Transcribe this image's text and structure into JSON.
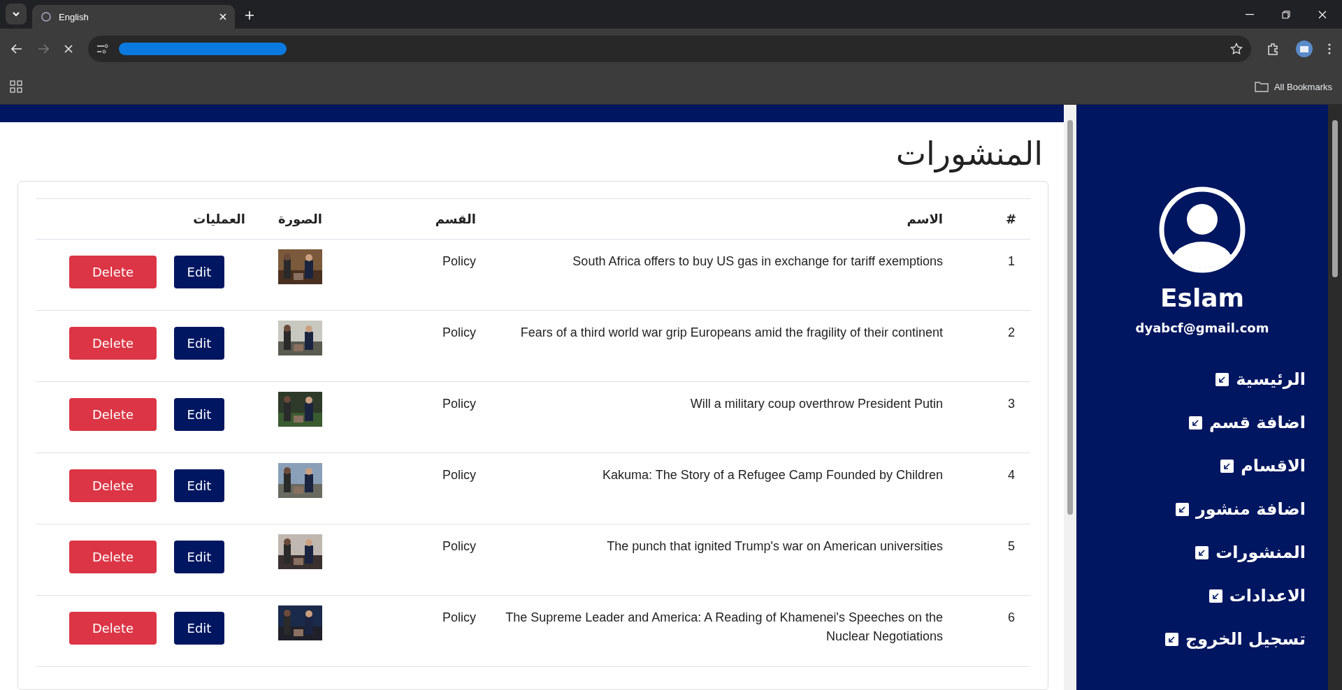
{
  "browser": {
    "tab_title": "English",
    "bookmarks_label": "All Bookmarks"
  },
  "page": {
    "title": "المنشورات",
    "table": {
      "columns": [
        "#",
        "الاسم",
        "القسم",
        "الصورة",
        "العمليات"
      ],
      "rows": [
        {
          "number": "1",
          "name": "South Africa offers to buy US gas in exchange for tariff exemptions",
          "category": "Policy",
          "edit_label": "Edit",
          "delete_label": "Delete"
        },
        {
          "number": "2",
          "name": "Fears of a third world war grip Europeans amid the fragility of their continent",
          "category": "Policy",
          "edit_label": "Edit",
          "delete_label": "Delete"
        },
        {
          "number": "3",
          "name": "Will a military coup overthrow President Putin",
          "category": "Policy",
          "edit_label": "Edit",
          "delete_label": "Delete"
        },
        {
          "number": "4",
          "name": "Kakuma: The Story of a Refugee Camp Founded by Children",
          "category": "Policy",
          "edit_label": "Edit",
          "delete_label": "Delete"
        },
        {
          "number": "5",
          "name": "The punch that ignited Trump's war on American universities",
          "category": "Policy",
          "edit_label": "Edit",
          "delete_label": "Delete"
        },
        {
          "number": "6",
          "name": "The Supreme Leader and America: A Reading of Khamenei's Speeches on the Nuclear Negotiations",
          "category": "Policy",
          "edit_label": "Edit",
          "delete_label": "Delete"
        }
      ]
    }
  },
  "sidebar": {
    "user": {
      "name": "Eslam",
      "email": "dyabcf@gmail.com"
    },
    "items": [
      {
        "label": "الرئيسية"
      },
      {
        "label": "اضافة قسم"
      },
      {
        "label": "الاقسام"
      },
      {
        "label": "اضافة منشور"
      },
      {
        "label": "المنشورات"
      },
      {
        "label": "الاعدادات"
      },
      {
        "label": "تسجيل الخروج"
      }
    ]
  }
}
